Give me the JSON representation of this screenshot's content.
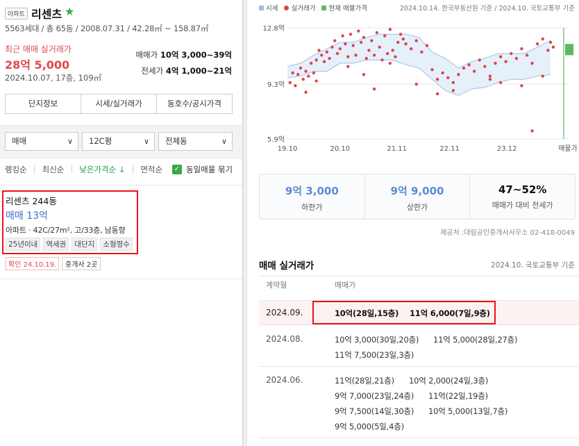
{
  "header": {
    "type_badge": "아파트",
    "name": "리센츠",
    "star": "★",
    "specs": "5563세대 / 총 65동 / 2008.07.31 / 42.28㎡ ~ 158.87㎡"
  },
  "recent": {
    "label": "최근 매매 실거래가",
    "price": "28억 5,000",
    "detail": "2024.10.07, 17층, 109㎡",
    "sale_range_label": "매매가",
    "sale_range": "10억 3,000~39억",
    "jeonse_range_label": "전세가",
    "jeonse_range": "4억 1,000~21억"
  },
  "info_tabs": [
    "단지정보",
    "시세/실거래가",
    "동호수/공시가격"
  ],
  "filters": {
    "trade": "매매",
    "size": "12C평",
    "building": "전체동"
  },
  "sort": {
    "items": [
      "랭킹순",
      "최신순",
      "낮은가격순 ↓",
      "면적순"
    ],
    "group_label": "동일매물 묶기"
  },
  "listing": {
    "title": "리센츠 244동",
    "price": "매매 13억",
    "info": "아파트 · 42C/27m², 고/33층, 남동향",
    "tags": [
      "25년이내",
      "역세권",
      "대단지",
      "소형평수"
    ],
    "confirmed": "확인 24.10.19.",
    "broker": "중개사 2곳"
  },
  "chart_legend": {
    "items": [
      "시세",
      "실거래가",
      "현재 매물가격"
    ],
    "source": "2024.10.14. 한국부동산원 기준 / 2024.10. 국토교통부 기준",
    "colors": {
      "band": "#9fbde8",
      "dot": "#d9464e",
      "current": "#5fb860"
    }
  },
  "chart_data": {
    "type": "scatter",
    "yticks": [
      "12.8억",
      "9.3억",
      "5.9억"
    ],
    "ytick_values": [
      12.8,
      9.3,
      5.9
    ],
    "ylim": [
      5.9,
      12.8
    ],
    "xticks": [
      "19.10",
      "20.10",
      "21.11",
      "22.11",
      "23.12",
      "매물가"
    ],
    "xtick_values": [
      2019.75,
      2020.75,
      2021.83,
      2022.83,
      2023.92
    ],
    "xlim": [
      2019.75,
      2024.92
    ],
    "band": {
      "x": [
        2019.75,
        2020.0,
        2020.25,
        2020.5,
        2020.75,
        2021.0,
        2021.25,
        2021.5,
        2021.75,
        2022.0,
        2022.25,
        2022.5,
        2022.75,
        2023.0,
        2023.25,
        2023.5,
        2023.75,
        2024.0,
        2024.25,
        2024.5,
        2024.75
      ],
      "upper": [
        10.4,
        10.6,
        11.1,
        11.5,
        11.9,
        11.9,
        12.2,
        12.4,
        12.4,
        12.4,
        12.2,
        11.3,
        10.9,
        10.3,
        10.7,
        10.9,
        11.2,
        11.2,
        11.2,
        11.6,
        12.0
      ],
      "lower": [
        9.7,
        9.8,
        10.1,
        10.1,
        10.6,
        10.6,
        10.8,
        10.8,
        10.8,
        10.5,
        10.3,
        9.6,
        8.9,
        8.6,
        9.0,
        9.1,
        9.4,
        9.6,
        9.6,
        9.8,
        9.9
      ]
    },
    "points": {
      "x": [
        2019.8,
        2019.85,
        2019.9,
        2019.95,
        2020.0,
        2020.05,
        2020.1,
        2020.15,
        2020.2,
        2020.25,
        2020.3,
        2020.35,
        2020.4,
        2020.45,
        2020.5,
        2020.55,
        2020.6,
        2020.65,
        2020.7,
        2020.75,
        2020.8,
        2020.85,
        2020.9,
        2020.95,
        2021.0,
        2021.05,
        2021.1,
        2021.15,
        2021.2,
        2021.25,
        2021.3,
        2021.35,
        2021.4,
        2021.45,
        2021.5,
        2021.55,
        2021.6,
        2021.65,
        2021.7,
        2021.75,
        2021.8,
        2021.85,
        2021.9,
        2021.95,
        2022.0,
        2022.1,
        2022.2,
        2022.3,
        2022.4,
        2022.5,
        2022.6,
        2022.7,
        2022.8,
        2022.9,
        2023.0,
        2023.1,
        2023.2,
        2023.3,
        2023.4,
        2023.5,
        2023.6,
        2023.7,
        2023.8,
        2023.9,
        2024.0,
        2024.1,
        2024.2,
        2024.3,
        2024.4,
        2024.5,
        2024.6,
        2024.7,
        2024.75,
        2024.8,
        2020.3,
        2020.9,
        2021.2,
        2021.7,
        2022.2,
        2022.9,
        2023.6,
        2024.2,
        2024.6,
        2020.1,
        2021.4,
        2022.6,
        2023.8,
        2024.4
      ],
      "y": [
        9.4,
        10.0,
        9.2,
        9.9,
        10.3,
        9.6,
        10.1,
        9.8,
        10.6,
        10.0,
        10.8,
        11.4,
        11.1,
        10.7,
        11.3,
        10.9,
        11.6,
        12.0,
        11.2,
        11.5,
        12.3,
        11.8,
        11.0,
        12.4,
        11.7,
        11.1,
        12.6,
        11.9,
        12.2,
        10.9,
        11.4,
        12.0,
        11.1,
        12.5,
        11.6,
        10.8,
        12.3,
        11.2,
        12.7,
        11.4,
        11.0,
        11.9,
        12.4,
        12.1,
        11.8,
        11.5,
        12.0,
        11.3,
        11.7,
        10.2,
        9.6,
        10.0,
        9.7,
        9.4,
        9.9,
        10.3,
        10.5,
        10.1,
        10.8,
        10.4,
        9.8,
        10.6,
        11.0,
        10.7,
        11.2,
        10.9,
        11.5,
        11.1,
        10.6,
        11.8,
        12.1,
        11.4,
        11.9,
        11.6,
        9.5,
        10.4,
        9.9,
        10.6,
        9.3,
        8.9,
        9.6,
        9.2,
        9.8,
        8.8,
        9.0,
        8.7,
        9.4,
        6.4
      ]
    },
    "current_listing": [
      11.1,
      11.8
    ]
  },
  "stats": [
    {
      "value": "9억 3,000",
      "label": "하한가"
    },
    {
      "value": "9억 9,000",
      "label": "상한가"
    },
    {
      "value": "47~52%",
      "label": "매매가 대비 전세가"
    }
  ],
  "provider": "제공처 :대림공인중개사사무소 02-418-0049",
  "transactions": {
    "title": "매매 실거래가",
    "source": "2024.10. 국토교통부 기준",
    "col_date": "계약월",
    "col_price": "매매가",
    "rows": [
      {
        "month": "2024.09.",
        "deals": [
          "10억(28일,15층)",
          "11억 6,000(7일,9층)"
        ]
      },
      {
        "month": "2024.08.",
        "deals": [
          "10억 3,000(30일,20층)",
          "11억 5,000(28일,27층)",
          "11억 7,500(23일,3층)"
        ]
      },
      {
        "month": "2024.06.",
        "deals": [
          "11억(28일,21층)",
          "10억 2,000(24일,3층)",
          "9억 7,000(23일,24층)",
          "11억(22일,19층)",
          "9억 7,500(14일,30층)",
          "10억 5,000(13일,7층)",
          "9억 5,000(5일,4층)"
        ]
      }
    ]
  }
}
